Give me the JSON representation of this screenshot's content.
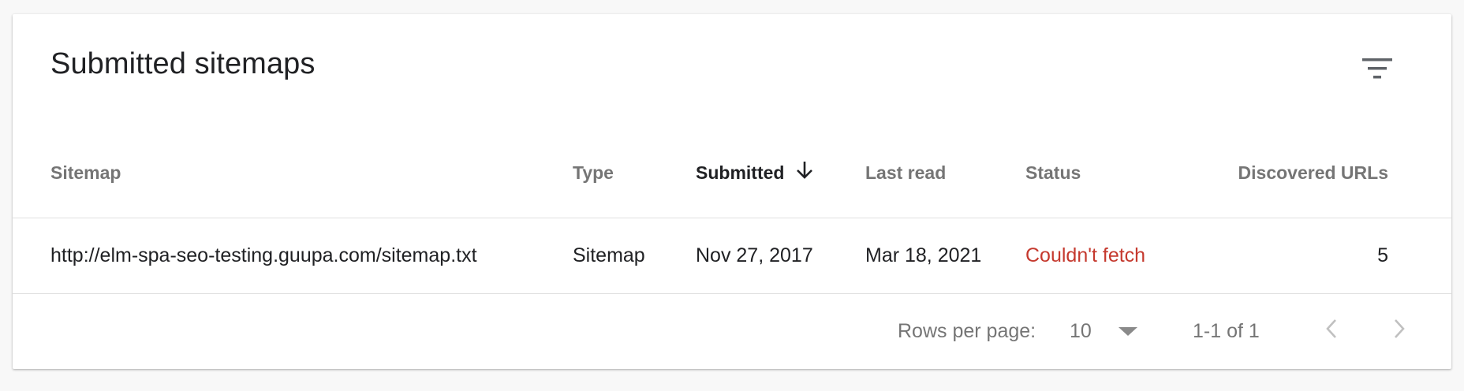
{
  "card": {
    "title": "Submitted sitemaps",
    "filter_icon": "filter-list-icon"
  },
  "table": {
    "columns": [
      {
        "label": "Sitemap",
        "sorted": false
      },
      {
        "label": "Type",
        "sorted": false
      },
      {
        "label": "Submitted",
        "sorted": true,
        "sort_icon": "arrow-down-icon"
      },
      {
        "label": "Last read",
        "sorted": false
      },
      {
        "label": "Status",
        "sorted": false
      },
      {
        "label": "Discovered URLs",
        "sorted": false
      }
    ],
    "rows": [
      {
        "sitemap": "http://elm-spa-seo-testing.guupa.com/sitemap.txt",
        "type": "Sitemap",
        "submitted": "Nov 27, 2017",
        "last_read": "Mar 18, 2021",
        "status": "Couldn't fetch",
        "discovered_urls": "5"
      }
    ]
  },
  "pagination": {
    "rows_per_page_label": "Rows per page:",
    "rows_per_page_value": "10",
    "range_text": "1-1 of 1",
    "prev_icon": "chevron-left-icon",
    "next_icon": "chevron-right-icon"
  },
  "colors": {
    "error_status": "#c5392e",
    "text_primary": "#202124",
    "text_secondary": "#757575"
  }
}
